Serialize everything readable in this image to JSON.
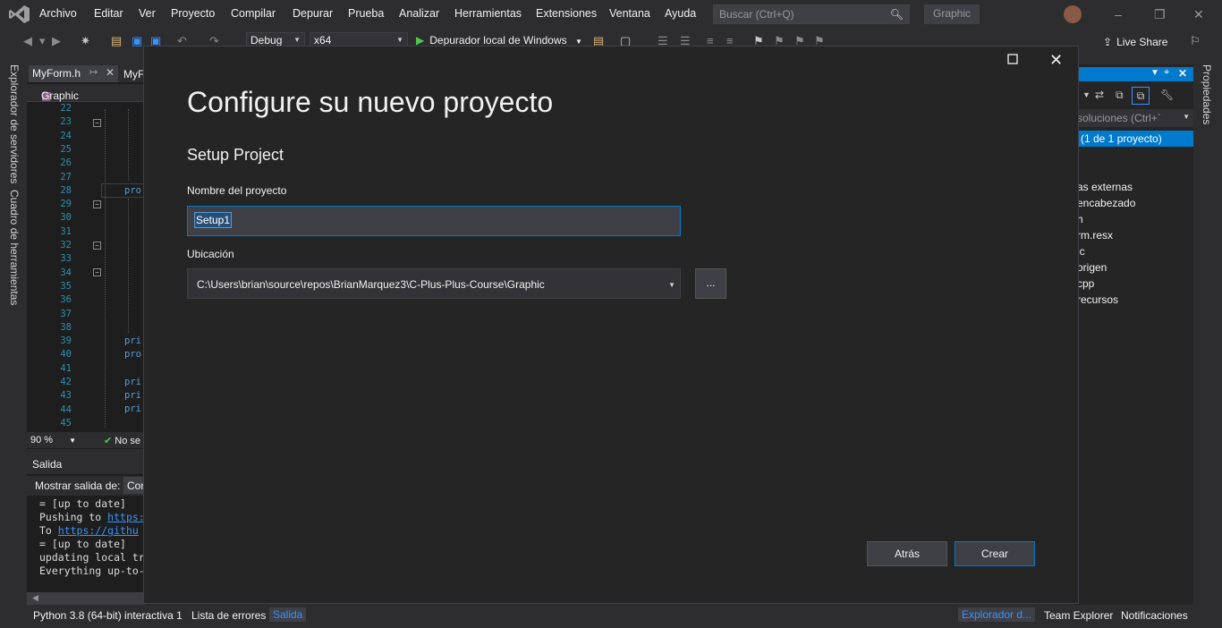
{
  "colors": {
    "accent": "#007acc",
    "background": "#2d2d30",
    "dialog": "#252526",
    "editor": "#1e1e1e",
    "link": "#3794ff"
  },
  "menubar": {
    "items": [
      "Archivo",
      "Editar",
      "Ver",
      "Proyecto",
      "Compilar",
      "Depurar",
      "Prueba",
      "Analizar",
      "Herramientas",
      "Extensiones",
      "Ventana",
      "Ayuda"
    ],
    "search_placeholder": "Buscar (Ctrl+Q)",
    "search_icon": "search-icon",
    "window_title": "Graphic"
  },
  "toolbar": {
    "configuration": "Debug",
    "platform": "x64",
    "debugger": "Depurador local de Windows",
    "live_share": "Live Share"
  },
  "left_strip": {
    "server_explorer": "Explorador de servidores",
    "toolbox": "Cuadro de herramientas"
  },
  "right_strip": {
    "properties": "Propiedades"
  },
  "editor": {
    "tab1": "MyForm.h",
    "tab2": "MyF",
    "nav": "Graphic",
    "lines": [
      "22",
      "23",
      "24",
      "25",
      "26",
      "27",
      "28",
      "29",
      "30",
      "31",
      "32",
      "33",
      "34",
      "35",
      "36",
      "37",
      "38",
      "39",
      "40",
      "41",
      "42",
      "43",
      "44",
      "45"
    ],
    "code_fragments": [
      "pro",
      "pri",
      "pro",
      "pri",
      "pri",
      "pri"
    ],
    "zoom": "90 %",
    "status": "No se"
  },
  "output": {
    "title": "Salida",
    "show_label": "Mostrar salida de:",
    "show_value": "Con",
    "lines": [
      {
        "text": " = [up to date]",
        "link": ""
      },
      {
        "text": "Pushing to ",
        "link": "https:"
      },
      {
        "text": "To ",
        "link": "https://githu"
      },
      {
        "text": " = [up to date]",
        "link": ""
      },
      {
        "text": "updating local tr",
        "link": ""
      },
      {
        "text": "Everything up-to-",
        "link": ""
      }
    ]
  },
  "solution": {
    "search": "soluciones (Ctrl+`",
    "selected": "(1 de 1 proyecto)",
    "items": [
      "as externas",
      "encabezado",
      "h",
      "rm.resx",
      "ic",
      "origen",
      "cpp",
      "recursos"
    ]
  },
  "dialog": {
    "title": "Configure su nuevo proyecto",
    "subtitle": "Setup Project",
    "name_label": "Nombre del proyecto",
    "name_value": "Setup1",
    "location_label": "Ubicación",
    "location_value": "C:\\Users\\brian\\source\\repos\\BrianMarquez3\\C-Plus-Plus-Course\\Graphic",
    "browse_label": "...",
    "back_label": "Atrás",
    "create_label": "Crear"
  },
  "statusbar": {
    "python": "Python 3.8 (64-bit) interactiva 1",
    "errors": "Lista de errores",
    "output": "Salida",
    "solution_explorer": "Explorador d...",
    "team_explorer": "Team Explorer",
    "notifications": "Notificaciones"
  }
}
